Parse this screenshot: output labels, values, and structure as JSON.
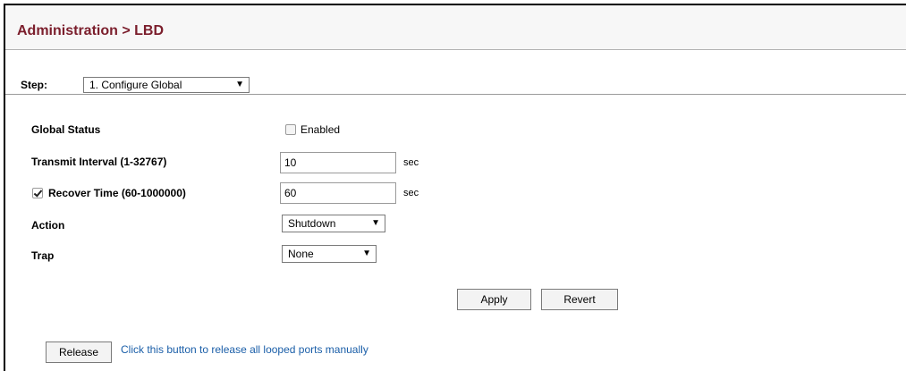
{
  "title": "Administration > LBD",
  "step": {
    "label": "Step:",
    "selected": "1. Configure Global"
  },
  "global_status": {
    "label": "Global Status",
    "checkbox_label": "Enabled",
    "checked": false
  },
  "transmit_interval": {
    "label": "Transmit Interval (1-32767)",
    "value": "10",
    "unit": "sec"
  },
  "recover_time": {
    "label": "Recover Time (60-1000000)",
    "checked": true,
    "value": "60",
    "unit": "sec"
  },
  "action": {
    "label": "Action",
    "selected": "Shutdown"
  },
  "trap": {
    "label": "Trap",
    "selected": "None"
  },
  "buttons": {
    "apply": "Apply",
    "revert": "Revert",
    "release": "Release"
  },
  "release_hint": "Click this button to release all looped ports manually",
  "colors": {
    "title": "#7b1e2c",
    "link": "#1a5ea8"
  }
}
